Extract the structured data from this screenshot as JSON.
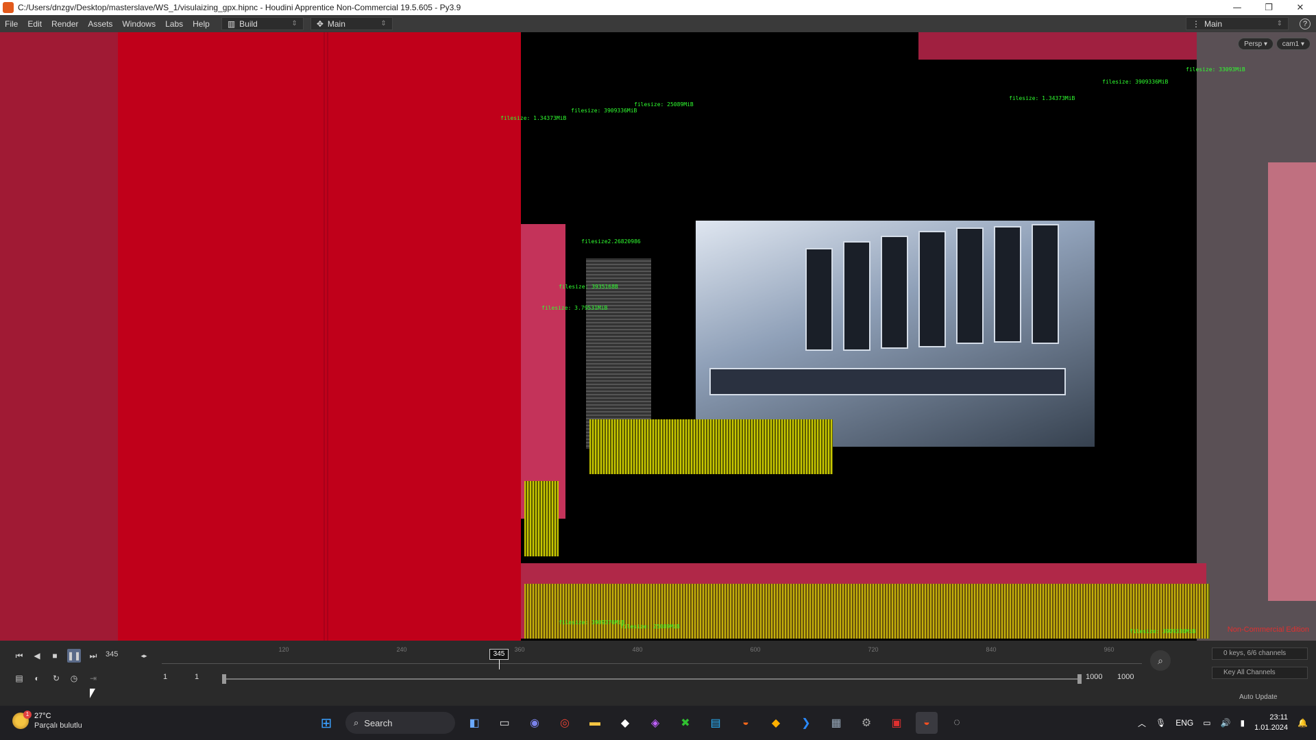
{
  "window": {
    "title": "C:/Users/dnzgv/Desktop/masterslave/WS_1/visulaizing_gpx.hipnc - Houdini Apprentice Non-Commercial 19.5.605 - Py3.9",
    "minimize": "—",
    "maximize": "❐",
    "close": "✕"
  },
  "menubar": {
    "items": [
      "File",
      "Edit",
      "Render",
      "Assets",
      "Windows",
      "Labs",
      "Help"
    ],
    "desktop_build": "Build",
    "desktop_main": "Main",
    "right_desk": "Main",
    "help": "?"
  },
  "viewport": {
    "persp_button": "Persp ▾",
    "cam_button": "cam1 ▾",
    "non_commercial": "Non-Commercial Edition",
    "labels": [
      {
        "text": "filesize: 1.34373MiB",
        "color": "green"
      },
      {
        "text": "filesize: 3909336MiB",
        "color": "green"
      },
      {
        "text": "filesize: 25089MiB",
        "color": "green"
      },
      {
        "text": "filesize: 3909336MiB",
        "color": "green"
      },
      {
        "text": "filesize: 1.34373MiB",
        "color": "green"
      },
      {
        "text": "filesize: 33093MiB",
        "color": "green"
      },
      {
        "text": "filesize2.26820986",
        "color": "green"
      },
      {
        "text": "filesize: 3935168B",
        "color": "green"
      },
      {
        "text": "filesize: 3.79531MiB",
        "color": "green"
      },
      {
        "text": "filesize: 3909376MiB",
        "color": "green"
      },
      {
        "text": "filesize: 25089MiB",
        "color": "green"
      },
      {
        "text": "filesize: 3909336MiB",
        "color": "green"
      }
    ]
  },
  "timeline": {
    "current_frame": "345",
    "playhead": "345",
    "ruler_ticks": [
      "120",
      "240",
      "360",
      "480",
      "600",
      "720",
      "840",
      "960"
    ],
    "range_start_a": "1",
    "range_start_b": "1",
    "range_end_a": "1000",
    "range_end_b": "1000",
    "keys_info": "0 keys, 6/6 channels",
    "key_all": "Key All Channels",
    "auto_update": "Auto Update"
  },
  "taskbar": {
    "temperature": "27°C",
    "weather": "Parçalı bulutlu",
    "weather_badge": "1",
    "search": "Search",
    "language": "ENG",
    "time": "23:11",
    "date": "1.01.2024"
  }
}
